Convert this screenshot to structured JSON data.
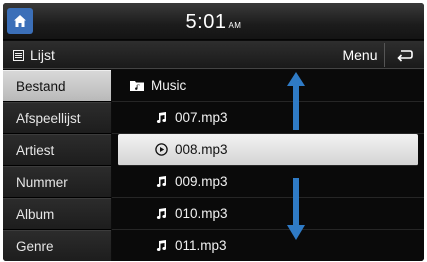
{
  "status": {
    "home_icon": "home-icon",
    "time": "5:01",
    "ampm": "AM"
  },
  "header": {
    "title": "Lijst",
    "list_icon": "list-icon",
    "menu_label": "Menu",
    "back_icon": "back-arrow-icon"
  },
  "sidebar": {
    "items": [
      {
        "label": "Bestand",
        "active": true
      },
      {
        "label": "Afspeellijst",
        "active": false
      },
      {
        "label": "Artiest",
        "active": false
      },
      {
        "label": "Nummer",
        "active": false
      },
      {
        "label": "Album",
        "active": false
      },
      {
        "label": "Genre",
        "active": false
      }
    ]
  },
  "list": {
    "folder": "Music",
    "files": [
      {
        "name": "007.mp3",
        "icon": "music-note-icon"
      },
      {
        "name": "008.mp3",
        "icon": "play-circle-icon",
        "selected": true
      },
      {
        "name": "009.mp3",
        "icon": "music-note-icon"
      },
      {
        "name": "010.mp3",
        "icon": "music-note-icon"
      },
      {
        "name": "011.mp3",
        "icon": "music-note-icon"
      }
    ]
  },
  "colors": {
    "accent_blue": "#3b6fb8",
    "arrow_blue": "#2f7bc6",
    "selection": "#e6e6e6"
  }
}
